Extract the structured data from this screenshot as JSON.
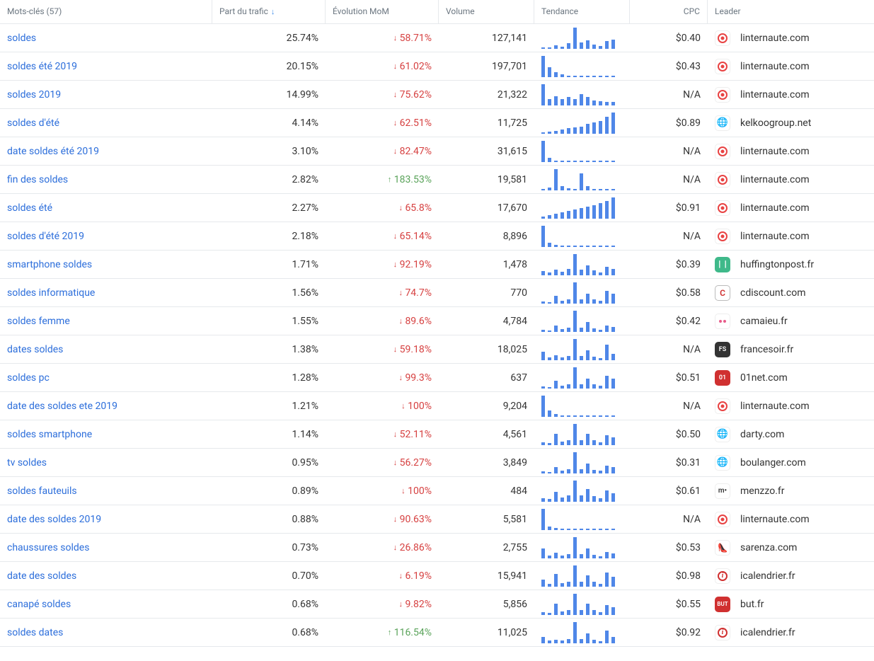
{
  "header": {
    "keywords": "Mots-clés (57)",
    "traffic": "Part du trafic",
    "mom": "Évolution MoM",
    "volume": "Volume",
    "trend": "Tendance",
    "cpc": "CPC",
    "leader": "Leader"
  },
  "rows": [
    {
      "kw": "soldes",
      "traffic": "25.74%",
      "mom": "58.71%",
      "dir": "down",
      "volume": "127,141",
      "cpc": "$0.40",
      "leader": "linternaute.com",
      "icon": "red",
      "trend": [
        1,
        2,
        5,
        3,
        8,
        30,
        9,
        12,
        6,
        4,
        11,
        13
      ]
    },
    {
      "kw": "soldes été 2019",
      "traffic": "20.15%",
      "mom": "61.02%",
      "dir": "down",
      "volume": "197,701",
      "cpc": "$0.43",
      "leader": "linternaute.com",
      "icon": "red",
      "trend": [
        30,
        14,
        7,
        4,
        2,
        1,
        1,
        1,
        1,
        1,
        1,
        1
      ]
    },
    {
      "kw": "soldes 2019",
      "traffic": "14.99%",
      "mom": "75.62%",
      "dir": "down",
      "volume": "21,322",
      "cpc": "N/A",
      "leader": "linternaute.com",
      "icon": "red",
      "trend": [
        30,
        9,
        13,
        9,
        12,
        9,
        16,
        12,
        7,
        6,
        5,
        5
      ]
    },
    {
      "kw": "soldes d'été",
      "traffic": "4.14%",
      "mom": "62.51%",
      "dir": "down",
      "volume": "11,725",
      "cpc": "$0.89",
      "leader": "kelkoogroup.net",
      "icon": "globe",
      "trend": [
        2,
        3,
        4,
        6,
        8,
        9,
        10,
        14,
        16,
        18,
        24,
        30
      ]
    },
    {
      "kw": "date soldes été 2019",
      "traffic": "3.10%",
      "mom": "82.47%",
      "dir": "down",
      "volume": "31,615",
      "cpc": "N/A",
      "leader": "linternaute.com",
      "icon": "red",
      "trend": [
        30,
        6,
        2,
        2,
        1,
        1,
        1,
        1,
        1,
        1,
        1,
        1
      ]
    },
    {
      "kw": "fin des soldes",
      "traffic": "2.82%",
      "mom": "183.53%",
      "dir": "up",
      "volume": "19,581",
      "cpc": "N/A",
      "leader": "linternaute.com",
      "icon": "red",
      "trend": [
        2,
        4,
        30,
        6,
        3,
        2,
        24,
        6,
        2,
        2,
        2,
        2
      ]
    },
    {
      "kw": "soldes été",
      "traffic": "2.27%",
      "mom": "65.8%",
      "dir": "down",
      "volume": "17,670",
      "cpc": "$0.91",
      "leader": "linternaute.com",
      "icon": "red",
      "trend": [
        3,
        5,
        7,
        9,
        11,
        13,
        15,
        17,
        19,
        22,
        25,
        30
      ]
    },
    {
      "kw": "soldes d'été 2019",
      "traffic": "2.18%",
      "mom": "65.14%",
      "dir": "down",
      "volume": "8,896",
      "cpc": "N/A",
      "leader": "linternaute.com",
      "icon": "red",
      "trend": [
        30,
        6,
        3,
        2,
        1,
        1,
        1,
        1,
        1,
        1,
        1,
        1
      ]
    },
    {
      "kw": "smartphone soldes",
      "traffic": "1.71%",
      "mom": "92.19%",
      "dir": "down",
      "volume": "1,478",
      "cpc": "$0.39",
      "leader": "huffingtonpost.fr",
      "icon": "green",
      "trend": [
        6,
        4,
        8,
        5,
        9,
        30,
        8,
        14,
        7,
        4,
        12,
        9
      ]
    },
    {
      "kw": "soldes informatique",
      "traffic": "1.56%",
      "mom": "74.7%",
      "dir": "down",
      "volume": "770",
      "cpc": "$0.58",
      "leader": "cdiscount.com",
      "icon": "cd",
      "trend": [
        3,
        2,
        11,
        4,
        6,
        30,
        6,
        14,
        6,
        4,
        18,
        14
      ]
    },
    {
      "kw": "soldes femme",
      "traffic": "1.55%",
      "mom": "89.6%",
      "dir": "down",
      "volume": "4,784",
      "cpc": "$0.42",
      "leader": "camaieu.fr",
      "icon": "pink",
      "trend": [
        3,
        2,
        9,
        4,
        6,
        30,
        6,
        14,
        5,
        3,
        9,
        7
      ]
    },
    {
      "kw": "dates soldes",
      "traffic": "1.38%",
      "mom": "59.18%",
      "dir": "down",
      "volume": "18,025",
      "cpc": "N/A",
      "leader": "francesoir.fr",
      "icon": "fs",
      "trend": [
        12,
        4,
        7,
        4,
        6,
        30,
        6,
        14,
        5,
        3,
        22,
        9
      ]
    },
    {
      "kw": "soldes pc",
      "traffic": "1.28%",
      "mom": "99.3%",
      "dir": "down",
      "volume": "637",
      "cpc": "$0.51",
      "leader": "01net.com",
      "icon": "o1",
      "trend": [
        3,
        2,
        11,
        4,
        6,
        30,
        6,
        14,
        6,
        4,
        18,
        14
      ]
    },
    {
      "kw": "date des soldes ete 2019",
      "traffic": "1.21%",
      "mom": "100%",
      "dir": "down",
      "volume": "9,204",
      "cpc": "N/A",
      "leader": "linternaute.com",
      "icon": "red",
      "trend": [
        30,
        9,
        4,
        2,
        2,
        1,
        1,
        1,
        1,
        1,
        1,
        1
      ]
    },
    {
      "kw": "soldes smartphone",
      "traffic": "1.14%",
      "mom": "52.11%",
      "dir": "down",
      "volume": "4,561",
      "cpc": "$0.50",
      "leader": "darty.com",
      "icon": "globe",
      "trend": [
        4,
        3,
        16,
        5,
        7,
        30,
        7,
        16,
        7,
        4,
        14,
        11
      ]
    },
    {
      "kw": "tv soldes",
      "traffic": "0.95%",
      "mom": "56.27%",
      "dir": "down",
      "volume": "3,849",
      "cpc": "$0.31",
      "leader": "boulanger.com",
      "icon": "globe",
      "trend": [
        3,
        2,
        9,
        4,
        6,
        30,
        6,
        14,
        5,
        4,
        11,
        9
      ]
    },
    {
      "kw": "soldes fauteuils",
      "traffic": "0.89%",
      "mom": "100%",
      "dir": "down",
      "volume": "484",
      "cpc": "$0.61",
      "leader": "menzzo.fr",
      "icon": "m",
      "trend": [
        5,
        4,
        14,
        6,
        9,
        30,
        9,
        18,
        8,
        5,
        16,
        12
      ]
    },
    {
      "kw": "date des soldes 2019",
      "traffic": "0.88%",
      "mom": "90.63%",
      "dir": "down",
      "volume": "5,581",
      "cpc": "N/A",
      "leader": "linternaute.com",
      "icon": "red",
      "trend": [
        30,
        5,
        3,
        2,
        1,
        1,
        1,
        1,
        1,
        1,
        1,
        1
      ]
    },
    {
      "kw": "chaussures soldes",
      "traffic": "0.73%",
      "mom": "26.86%",
      "dir": "down",
      "volume": "2,755",
      "cpc": "$0.53",
      "leader": "sarenza.com",
      "icon": "shoe",
      "trend": [
        14,
        4,
        8,
        4,
        6,
        30,
        6,
        14,
        5,
        3,
        9,
        7
      ]
    },
    {
      "kw": "date des soldes",
      "traffic": "0.70%",
      "mom": "6.19%",
      "dir": "down",
      "volume": "15,941",
      "cpc": "$0.98",
      "leader": "icalendrier.fr",
      "icon": "info",
      "trend": [
        10,
        4,
        18,
        5,
        7,
        30,
        7,
        16,
        7,
        4,
        20,
        14
      ]
    },
    {
      "kw": "canapé soldes",
      "traffic": "0.68%",
      "mom": "9.82%",
      "dir": "down",
      "volume": "5,856",
      "cpc": "$0.55",
      "leader": "but.fr",
      "icon": "but",
      "trend": [
        4,
        3,
        16,
        5,
        7,
        30,
        7,
        16,
        7,
        4,
        14,
        11
      ]
    },
    {
      "kw": "soldes dates",
      "traffic": "0.68%",
      "mom": "116.54%",
      "dir": "up",
      "volume": "11,025",
      "cpc": "$0.92",
      "leader": "icalendrier.fr",
      "icon": "info",
      "trend": [
        9,
        4,
        5,
        4,
        6,
        30,
        6,
        14,
        5,
        3,
        18,
        9
      ]
    }
  ]
}
